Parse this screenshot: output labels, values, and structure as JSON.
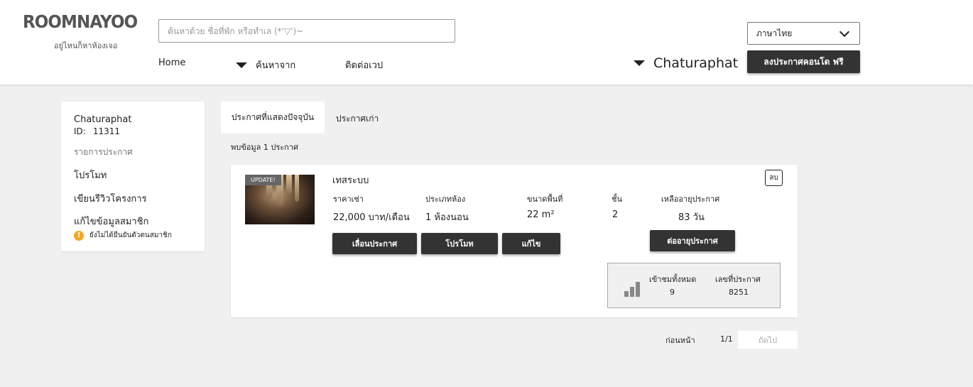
{
  "header": {
    "logo": "ROOMNAYOO",
    "tagline": "อยู่ไหนก็หาห้องเจอ",
    "search_placeholder": "ค้นหาด้วย ชื่อที่พัก หรือทำเล (*'▽')~",
    "nav": {
      "home": "Home",
      "search_from": "ค้นหาจาก",
      "contact": "ติดต่อเวป"
    },
    "user_name": "Chaturaphat",
    "language": "ภาษาไทย",
    "post_button": "ลงประกาศคอนโด ฟรี"
  },
  "sidebar": {
    "name": "Chaturaphat",
    "id_label": "ID:",
    "id_value": "11311",
    "listing_label": "รายการประกาศ",
    "promote": "โปรโมท",
    "write_review": "เขียนรีวิวโครงการ",
    "edit_member": "แก้ไขข้อมูลสมาชิก",
    "warning": "ยังไม่ได้ยืนยันตัวตนสมาชิก"
  },
  "tabs": {
    "current": "ประกาศที่แสดงปัจจุบัน",
    "old": "ประกาศเก่า"
  },
  "found_text": "พบข้อมูล 1 ประกาศ",
  "listing": {
    "badge": "UPDATE!",
    "title": "เทสระบบ",
    "delete": "ลบ",
    "rent_label": "ราคาเช่า",
    "rent_value": "22,000 บาท/เดือน",
    "room_type_label": "ประเภทห้อง",
    "room_type_value": "1 ห้องนอน",
    "area_label": "ขนาดพื้นที่",
    "area_value": "22 m²",
    "floor_label": "ชั้น",
    "floor_value": "2",
    "expiry_label": "เหลืออายุประกาศ",
    "expiry_value": "83 วัน",
    "bump_button": "เลื่อนประกาศ",
    "promote_button": "โปรโมท",
    "edit_button": "แก้ไข",
    "renew_button": "ต่ออายุประกาศ",
    "views_label": "เข้าชมทั้งหมด",
    "views_value": "9",
    "listing_no_label": "เลขที่ประกาศ",
    "listing_no_value": "8251"
  },
  "pagination": {
    "prev": "ก่อนหน้า",
    "page": "1/1",
    "next": "ถัดไป"
  }
}
